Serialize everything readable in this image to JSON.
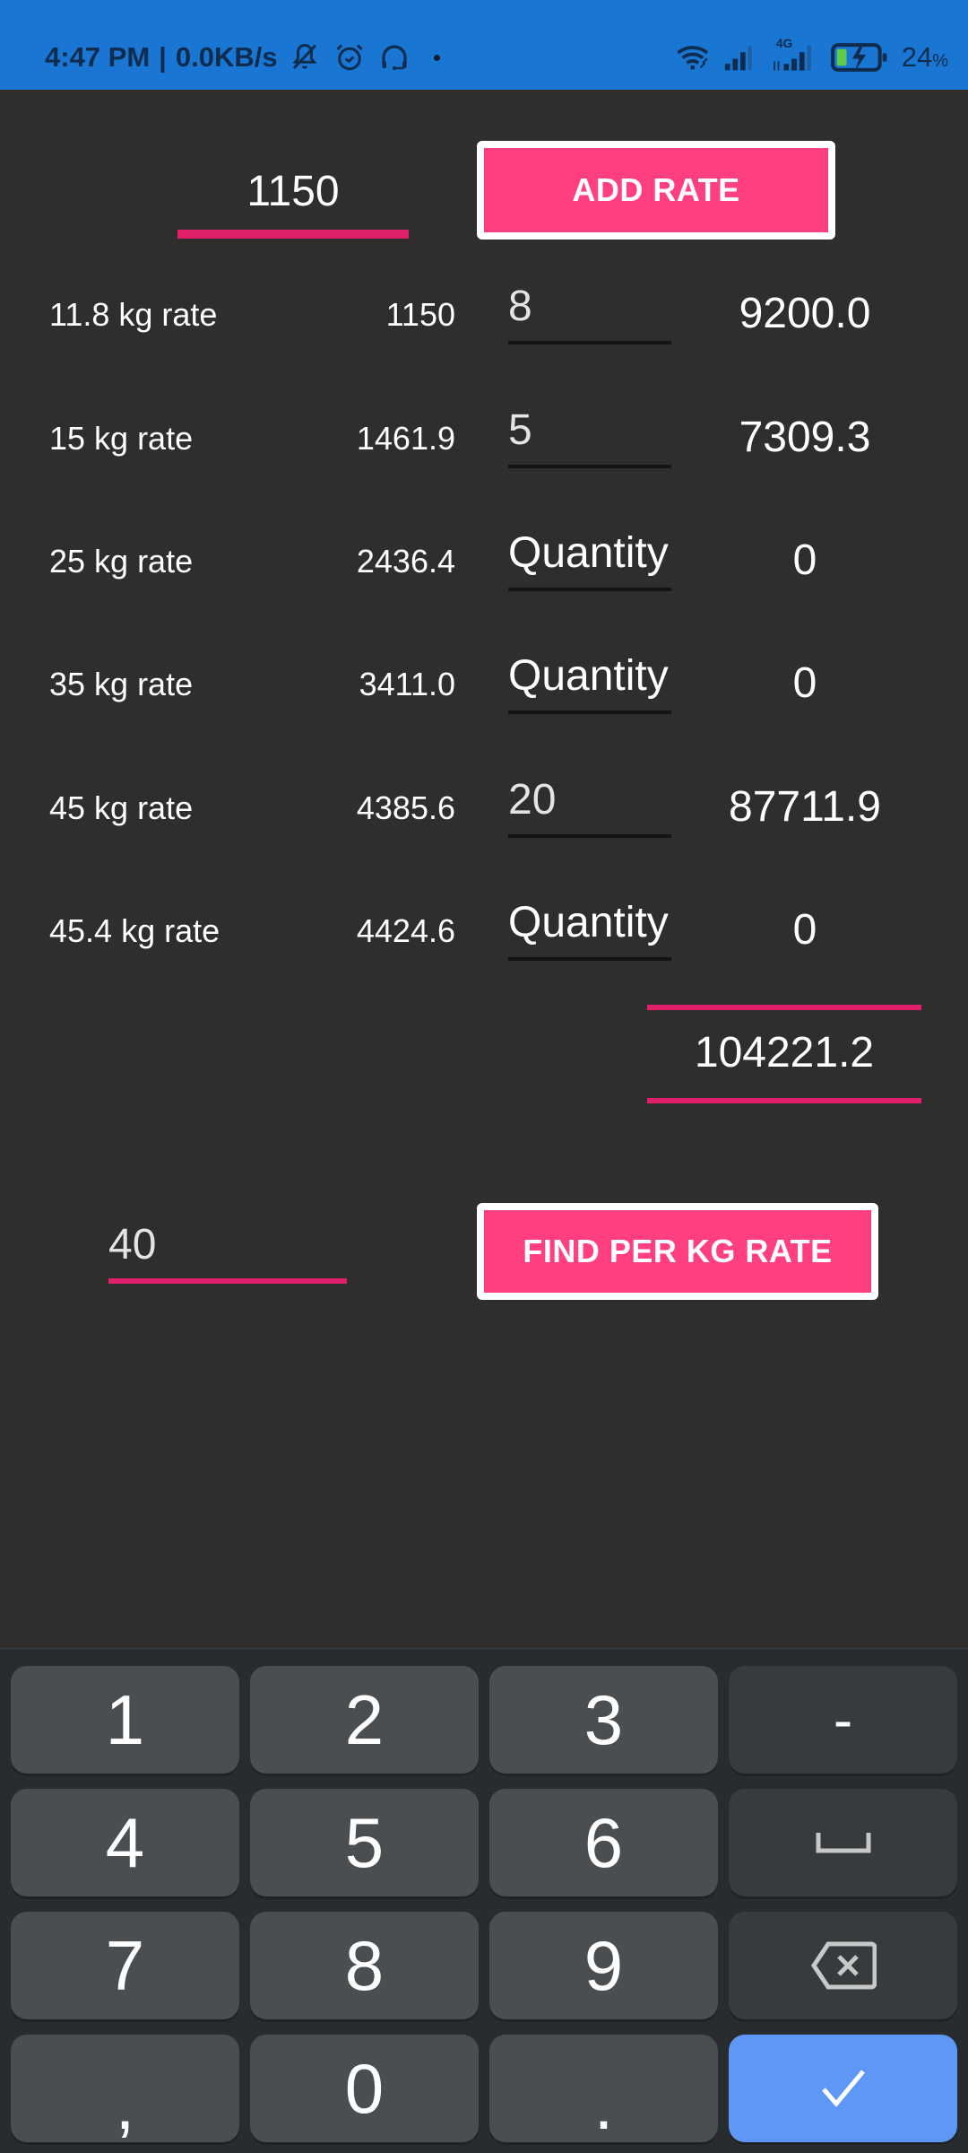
{
  "status_bar": {
    "time": "4:47 PM",
    "separator": "|",
    "net_speed": "0.0KB/s",
    "left_icons": [
      "bell-muted-icon",
      "alarm-icon",
      "headset-icon",
      "dot-indicator"
    ],
    "right_icons": [
      "wifi-icon",
      "signal-sim1-icon",
      "signal-4g-icon",
      "battery-charging-icon"
    ],
    "network_type": "4G",
    "battery_percent": "24",
    "battery_percent_sign": "%",
    "battery_level": 0.24
  },
  "rate_input": {
    "value": "1150"
  },
  "add_rate_button": {
    "label": "ADD RATE"
  },
  "rows": [
    {
      "label": "11.8 kg rate",
      "rate": "1150",
      "quantity": "8",
      "quantity_is_hint": false,
      "amount": "9200.0"
    },
    {
      "label": "15 kg rate",
      "rate": "1461.9",
      "quantity": "5",
      "quantity_is_hint": false,
      "amount": "7309.3"
    },
    {
      "label": "25 kg rate",
      "rate": "2436.4",
      "quantity": "Quantity",
      "quantity_is_hint": true,
      "amount": "0"
    },
    {
      "label": "35 kg rate",
      "rate": "3411.0",
      "quantity": "Quantity",
      "quantity_is_hint": true,
      "amount": "0"
    },
    {
      "label": "45 kg rate",
      "rate": "4385.6",
      "quantity": "20",
      "quantity_is_hint": false,
      "amount": "87711.9"
    },
    {
      "label": "45.4 kg rate",
      "rate": "4424.6",
      "quantity": "Quantity",
      "quantity_is_hint": true,
      "amount": "0"
    }
  ],
  "total": {
    "value": "104221.2"
  },
  "kg_input": {
    "value": "40"
  },
  "find_button": {
    "label": "FIND PER KG RATE"
  },
  "keyboard": {
    "keys": [
      {
        "label": "1",
        "type": "digit"
      },
      {
        "label": "2",
        "type": "digit"
      },
      {
        "label": "3",
        "type": "digit"
      },
      {
        "label": "-",
        "type": "fn",
        "name": "minus-key"
      },
      {
        "label": "4",
        "type": "digit"
      },
      {
        "label": "5",
        "type": "digit"
      },
      {
        "label": "6",
        "type": "digit"
      },
      {
        "label": "",
        "type": "fn",
        "name": "space-key",
        "icon": "space-icon"
      },
      {
        "label": "7",
        "type": "digit"
      },
      {
        "label": "8",
        "type": "digit"
      },
      {
        "label": "9",
        "type": "digit"
      },
      {
        "label": "",
        "type": "fn",
        "name": "backspace-key",
        "icon": "backspace-icon"
      },
      {
        "label": ",",
        "type": "digit",
        "name": "comma-key"
      },
      {
        "label": "0",
        "type": "digit"
      },
      {
        "label": ".",
        "type": "digit",
        "name": "period-key"
      },
      {
        "label": "",
        "type": "ok",
        "name": "done-key",
        "icon": "check-icon"
      }
    ]
  },
  "colors": {
    "status_bar": "#1976d2",
    "background": "#302e2c",
    "accent_pink": "#ff3f7f",
    "underline_pink": "#e0206a",
    "keyboard_bg": "#292c2f",
    "key_bg": "#4a4e51",
    "key_fn_bg": "#373b3d",
    "key_ok_bg": "#5e97f6"
  }
}
